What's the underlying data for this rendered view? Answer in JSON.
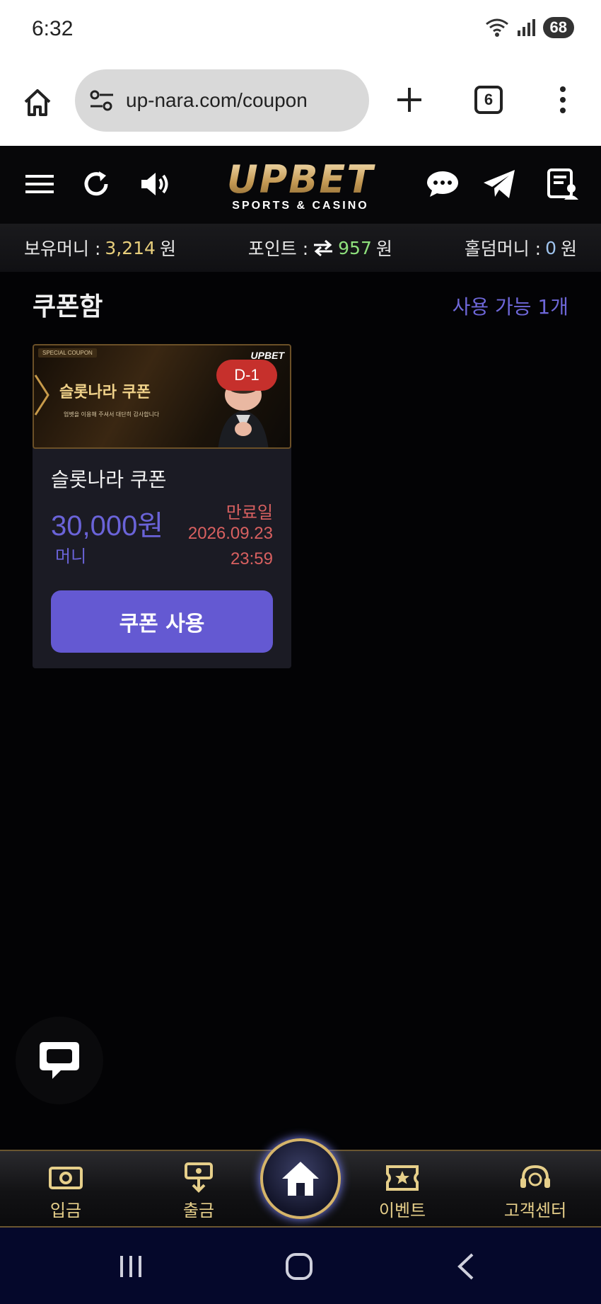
{
  "status_bar": {
    "time": "6:32",
    "battery": "68"
  },
  "browser": {
    "url": "up-nara.com/coupon",
    "tab_count": "6"
  },
  "site": {
    "logo_main": "UPBET",
    "logo_sub": "SPORTS & CASINO"
  },
  "balance": {
    "money_label": "보유머니 :",
    "money_value": "3,214",
    "money_unit": "원",
    "point_label": "포인트 :",
    "point_value": "957",
    "point_unit": "원",
    "holdem_label": "홀덤머니 :",
    "holdem_value": "0",
    "holdem_unit": "원"
  },
  "coupon_box": {
    "title": "쿠폰함",
    "available": "사용 가능 1개",
    "coupon": {
      "banner_tag": "SPECIAL COUPON",
      "banner_title": "슬롯나라 쿠폰",
      "banner_desc": "업벳을 이용해 주셔서 대단히 감사합니다",
      "banner_logo": "UPBET",
      "dday": "D-1",
      "name": "슬롯나라 쿠폰",
      "amount": "30,000원",
      "type": "머니",
      "expire_label": "만료일",
      "expire_date": "2026.09.23",
      "expire_time": "23:59",
      "use_label": "쿠폰 사용"
    }
  },
  "bottom_nav": {
    "deposit": "입금",
    "withdraw": "출금",
    "event": "이벤트",
    "support": "고객센터"
  },
  "colors": {
    "accent": "#6459d2",
    "gold": "#d5b46a",
    "expire": "#d86060"
  }
}
